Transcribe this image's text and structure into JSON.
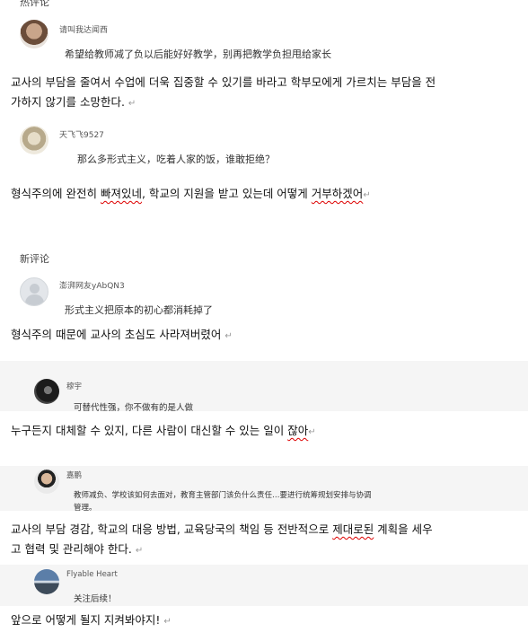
{
  "top_header": "热评论",
  "comments": [
    {
      "user": "请叫我达闻西",
      "text": "希望给教师减了负以后能好好教学，别再把教学负担甩给家长",
      "ko": [
        "교사의 부담을 줄여서 수업에 더욱 집중할 수 있기를 바라고 학부모에게 가르치는 부담을 전",
        "가하지 않기를 소망한다."
      ]
    },
    {
      "user": "天飞飞9527",
      "text": "那么多形式主义，吃着人家的饭，谁敢拒绝？",
      "ko": [
        "형식주의에 완전히 빠져있네, 학교의 지원을 받고 있는데 어떻게 거부하겠어"
      ]
    },
    {
      "user": "澎湃网友yAbQN3",
      "text": "形式主义把原本的初心都消耗掉了",
      "ko": [
        "형식주의 때문에 교사의 초심도 사라져버렸어"
      ]
    },
    {
      "user": "穆宇",
      "text": "可替代性强，你不做有的是人做",
      "ko": [
        "누구든지 대체할 수 있지, 다른 사람이 대신할 수 있는 일이 잖아"
      ]
    },
    {
      "user": "嘉鹏",
      "text": "教师减负、学校该如何去面对，教育主管部门该负什么责任…要进行统筹规划安排与协调",
      "text2": "管理。",
      "ko": [
        "교사의 부담 경감, 학교의 대응 방법, 교육당국의 책임 등 전반적으로 제대로된 계획을 세우",
        "고 협력 및 관리해야 한다."
      ]
    },
    {
      "user": "Flyable Heart",
      "text": "关注后续！",
      "ko": [
        "앞으로 어떻게 될지 지켜봐야지!"
      ]
    }
  ],
  "new_section_title": "新评论",
  "return_mark": "↵"
}
